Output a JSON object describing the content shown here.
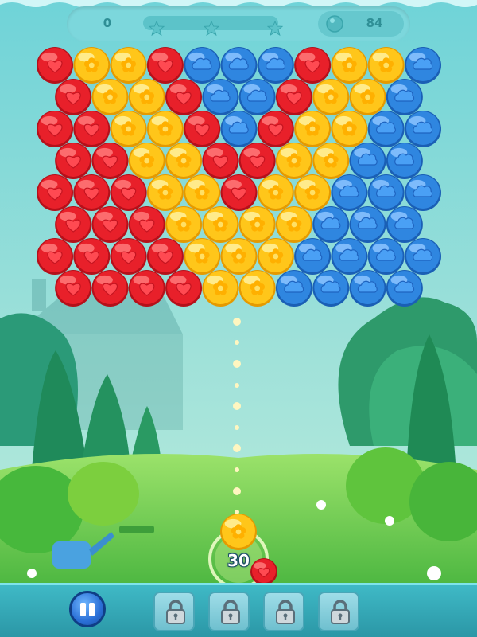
{
  "hud": {
    "score": "0",
    "progress": 0.0,
    "stars_earned": 0,
    "stars_total": 3,
    "balls_remaining": "84"
  },
  "shooter": {
    "shots_left": "30",
    "current_bubble": "yellow-flower",
    "next_bubble": "red-heart"
  },
  "bubble_colors": {
    "red-heart": "#e8202a",
    "yellow-flower": "#ffc61a",
    "blue-cloud": "#2f86e0"
  },
  "bubble_grid": [
    [
      "red-heart",
      "yellow-flower",
      "yellow-flower",
      "red-heart",
      "blue-cloud",
      "blue-cloud",
      "blue-cloud",
      "red-heart",
      "yellow-flower",
      "yellow-flower",
      "blue-cloud"
    ],
    [
      "red-heart",
      "yellow-flower",
      "yellow-flower",
      "red-heart",
      "blue-cloud",
      "blue-cloud",
      "red-heart",
      "yellow-flower",
      "yellow-flower",
      "blue-cloud"
    ],
    [
      "red-heart",
      "red-heart",
      "yellow-flower",
      "yellow-flower",
      "red-heart",
      "blue-cloud",
      "red-heart",
      "yellow-flower",
      "yellow-flower",
      "blue-cloud",
      "blue-cloud"
    ],
    [
      "red-heart",
      "red-heart",
      "yellow-flower",
      "yellow-flower",
      "red-heart",
      "red-heart",
      "yellow-flower",
      "yellow-flower",
      "blue-cloud",
      "blue-cloud"
    ],
    [
      "red-heart",
      "red-heart",
      "red-heart",
      "yellow-flower",
      "yellow-flower",
      "red-heart",
      "yellow-flower",
      "yellow-flower",
      "blue-cloud",
      "blue-cloud",
      "blue-cloud"
    ],
    [
      "red-heart",
      "red-heart",
      "red-heart",
      "yellow-flower",
      "yellow-flower",
      "yellow-flower",
      "yellow-flower",
      "blue-cloud",
      "blue-cloud",
      "blue-cloud"
    ],
    [
      "red-heart",
      "red-heart",
      "red-heart",
      "red-heart",
      "yellow-flower",
      "yellow-flower",
      "yellow-flower",
      "blue-cloud",
      "blue-cloud",
      "blue-cloud",
      "blue-cloud"
    ],
    [
      "red-heart",
      "red-heart",
      "red-heart",
      "red-heart",
      "yellow-flower",
      "yellow-flower",
      "blue-cloud",
      "blue-cloud",
      "blue-cloud",
      "blue-cloud"
    ]
  ],
  "boosters": [
    {
      "name": "booster-slot-1",
      "state": "locked",
      "icon": "padlock-icon"
    },
    {
      "name": "booster-slot-2",
      "state": "locked",
      "icon": "padlock-icon"
    },
    {
      "name": "booster-slot-3",
      "state": "locked",
      "icon": "padlock-icon"
    },
    {
      "name": "booster-slot-4",
      "state": "locked",
      "icon": "padlock-icon"
    }
  ],
  "controls": {
    "pause_icon": "pause-icon"
  }
}
